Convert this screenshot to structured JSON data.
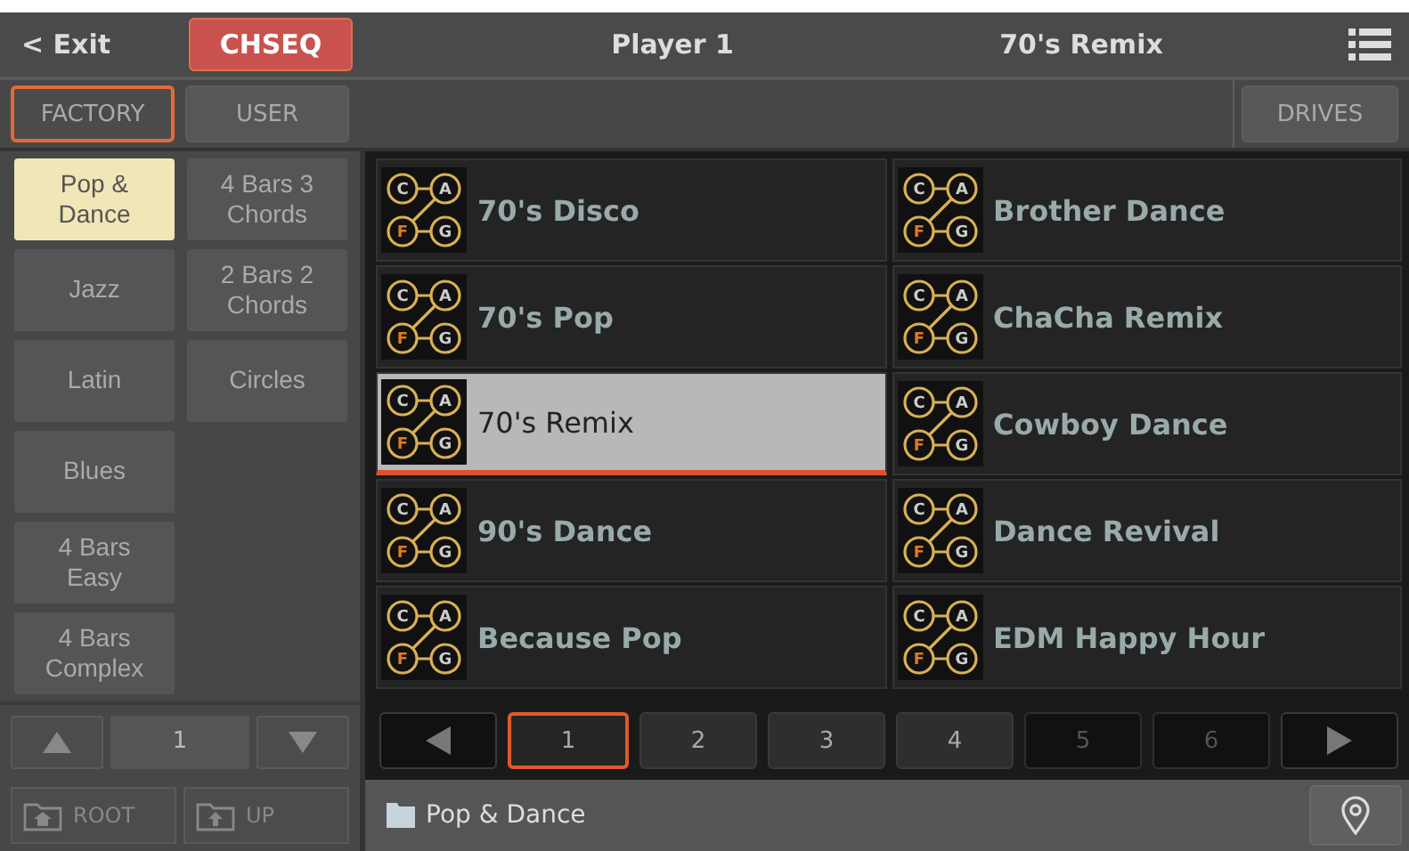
{
  "header": {
    "exit": "< Exit",
    "mode": "CHSEQ",
    "player": "Player 1",
    "current": "70's Remix"
  },
  "tabs": [
    {
      "label": "FACTORY",
      "selected": true
    },
    {
      "label": "USER",
      "selected": false
    }
  ],
  "drives": "DRIVES",
  "folders": [
    {
      "label": "Pop & Dance",
      "selected": true
    },
    {
      "label": "Jazz",
      "selected": false
    },
    {
      "label": "Latin",
      "selected": false
    },
    {
      "label": "Blues",
      "selected": false
    },
    {
      "label": "4 Bars Easy",
      "selected": false
    },
    {
      "label": "4 Bars Complex",
      "selected": false
    },
    {
      "label": "4 Bars 3 Chords",
      "selected": false
    },
    {
      "label": "2 Bars 2 Chords",
      "selected": false
    },
    {
      "label": "Circles",
      "selected": false
    }
  ],
  "folder_page": "1",
  "items": [
    {
      "name": "70's Disco",
      "selected": false,
      "icon": [
        "C",
        "A",
        "F",
        "G"
      ]
    },
    {
      "name": "Brother Dance",
      "selected": false,
      "icon": [
        "C",
        "A",
        "F",
        "G"
      ]
    },
    {
      "name": "70's Pop",
      "selected": false,
      "icon": [
        "C",
        "A",
        "F",
        "G"
      ]
    },
    {
      "name": "ChaCha Remix",
      "selected": false,
      "icon": [
        "C",
        "A",
        "F",
        "G"
      ]
    },
    {
      "name": "70's Remix",
      "selected": true,
      "icon": [
        "C",
        "A",
        "F",
        "G"
      ]
    },
    {
      "name": "Cowboy Dance",
      "selected": false,
      "icon": [
        "C",
        "A",
        "F",
        "G"
      ]
    },
    {
      "name": "90's Dance",
      "selected": false,
      "icon": [
        "C",
        "A",
        "F",
        "G"
      ]
    },
    {
      "name": "Dance Revival",
      "selected": false,
      "icon": [
        "C",
        "A",
        "F",
        "G"
      ]
    },
    {
      "name": "Because Pop",
      "selected": false,
      "icon": [
        "C",
        "A",
        "F",
        "G"
      ]
    },
    {
      "name": "EDM Happy Hour",
      "selected": false,
      "icon": [
        "C",
        "A",
        "F",
        "G"
      ]
    }
  ],
  "pages": [
    {
      "label": "1",
      "selected": true,
      "disabled": false
    },
    {
      "label": "2",
      "selected": false,
      "disabled": false
    },
    {
      "label": "3",
      "selected": false,
      "disabled": false
    },
    {
      "label": "4",
      "selected": false,
      "disabled": false
    },
    {
      "label": "5",
      "selected": false,
      "disabled": true
    },
    {
      "label": "6",
      "selected": false,
      "disabled": true
    }
  ],
  "nav": {
    "root": "ROOT",
    "up": "UP"
  },
  "path": "Pop & Dance"
}
